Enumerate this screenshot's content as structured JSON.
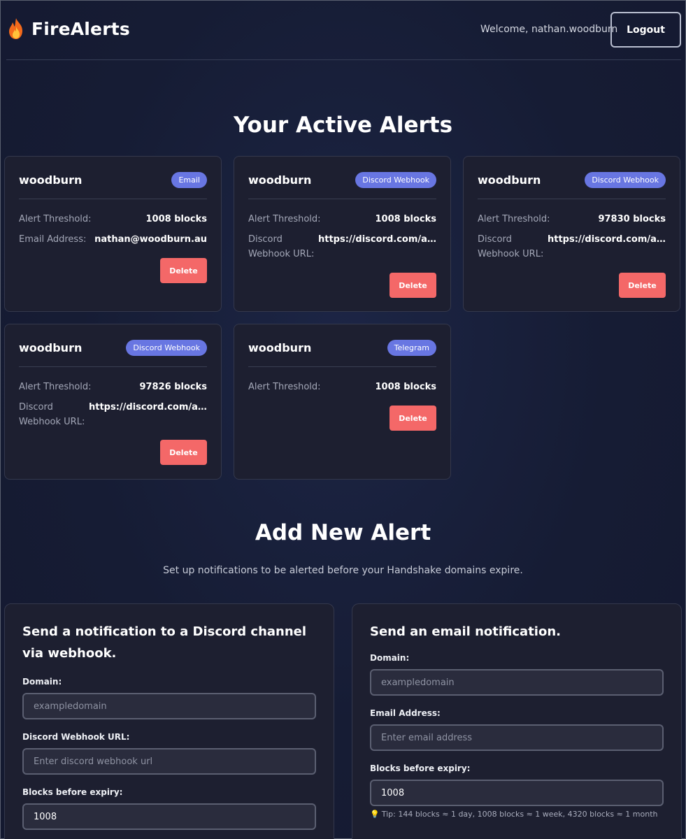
{
  "header": {
    "brand": "FireAlerts",
    "brand_icon": "flame-icon",
    "welcome": "Welcome, nathan.woodburn",
    "logout_label": "Logout"
  },
  "alerts_section": {
    "title": "Your Active Alerts"
  },
  "alerts": [
    {
      "name": "woodburn",
      "type": "Email",
      "threshold_label": "Alert Threshold:",
      "threshold": "1008 blocks",
      "target_label": "Email Address:",
      "target": "nathan@woodburn.au",
      "delete_label": "Delete"
    },
    {
      "name": "woodburn",
      "type": "Discord Webhook",
      "threshold_label": "Alert Threshold:",
      "threshold": "1008 blocks",
      "target_label": "Discord Webhook URL:",
      "target": "https://discord.com/api/...",
      "delete_label": "Delete"
    },
    {
      "name": "woodburn",
      "type": "Discord Webhook",
      "threshold_label": "Alert Threshold:",
      "threshold": "97830 blocks",
      "target_label": "Discord Webhook URL:",
      "target": "https://discord.com/api/...",
      "delete_label": "Delete"
    },
    {
      "name": "woodburn",
      "type": "Discord Webhook",
      "threshold_label": "Alert Threshold:",
      "threshold": "97826 blocks",
      "target_label": "Discord Webhook URL:",
      "target": "https://discord.com/api/...",
      "delete_label": "Delete"
    },
    {
      "name": "woodburn",
      "type": "Telegram",
      "threshold_label": "Alert Threshold:",
      "threshold": "1008 blocks",
      "delete_label": "Delete"
    }
  ],
  "add_section": {
    "title": "Add New Alert",
    "subtitle": "Set up notifications to be alerted before your Handshake domains expire."
  },
  "discord_form": {
    "title": "Send a notification to a Discord channel via webhook.",
    "domain_label": "Domain:",
    "domain_placeholder": "exampledomain",
    "webhook_label": "Discord Webhook URL:",
    "webhook_placeholder": "Enter discord webhook url",
    "blocks_label": "Blocks before expiry:",
    "blocks_value": "1008"
  },
  "email_form": {
    "title": "Send an email notification.",
    "domain_label": "Domain:",
    "domain_placeholder": "exampledomain",
    "email_label": "Email Address:",
    "email_placeholder": "Enter email address",
    "blocks_label": "Blocks before expiry:",
    "blocks_value": "1008",
    "tip_icon": "lightbulb-icon",
    "tip": "Tip: 144 blocks ≈ 1 day, 1008 blocks ≈ 1 week, 4320 blocks ≈ 1 month"
  },
  "colors": {
    "accent_badge": "#6876e2",
    "delete": "#f46868",
    "card_bg": "#1d1f30"
  }
}
